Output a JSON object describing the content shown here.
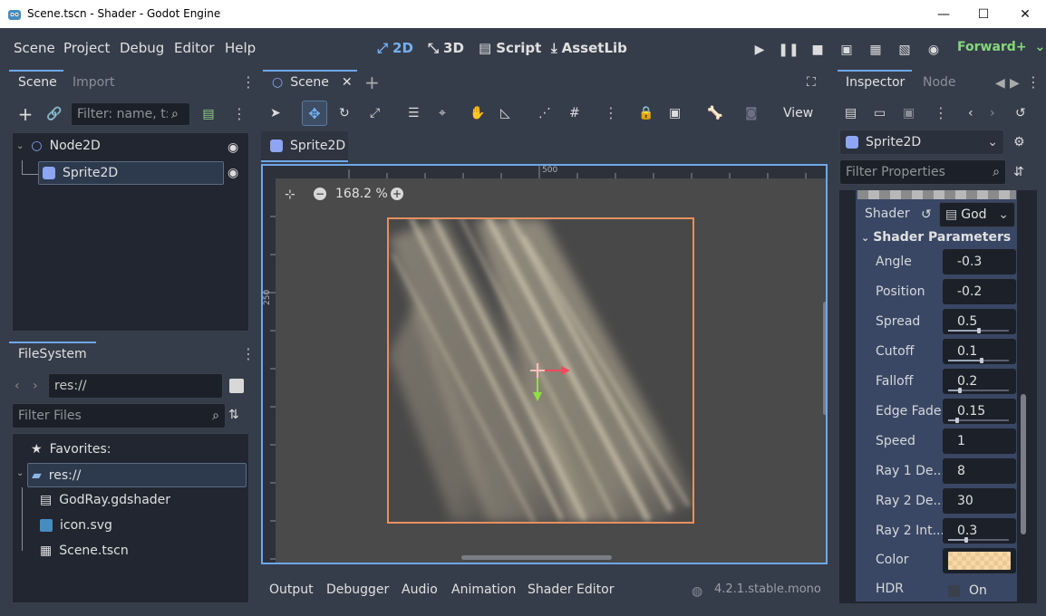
{
  "window": {
    "title": "Scene.tscn - Shader - Godot Engine",
    "minimize": "—",
    "maximize": "☐",
    "close": "✕"
  },
  "menu": {
    "items": [
      "Scene",
      "Project",
      "Debug",
      "Editor",
      "Help"
    ],
    "workspaces": [
      "2D",
      "3D",
      "Script",
      "AssetLib"
    ],
    "renderer": "Forward+"
  },
  "scene_dock": {
    "tabs": [
      "Scene",
      "Import"
    ],
    "filter_placeholder": "Filter: name, t:t",
    "nodes": [
      "Node2D",
      "Sprite2D"
    ]
  },
  "filesystem_dock": {
    "tab": "FileSystem",
    "path": "res://",
    "filter_placeholder": "Filter Files",
    "favorites": "Favorites:",
    "root": "res://",
    "files": [
      "GodRay.gdshader",
      "icon.svg",
      "Scene.tscn"
    ]
  },
  "editor": {
    "scene_tab": "Scene",
    "view_menu": "View",
    "node_tab": "Sprite2D",
    "zoom": "168.2 %",
    "ruler_x": "500",
    "ruler_y": "250",
    "bottom_tabs": [
      "Output",
      "Debugger",
      "Audio",
      "Animation",
      "Shader Editor"
    ],
    "version": "4.2.1.stable.mono"
  },
  "inspector": {
    "tabs": [
      "Inspector",
      "Node"
    ],
    "object": "Sprite2D",
    "filter_placeholder": "Filter Properties",
    "shader_label": "Shader",
    "shader_value": "God",
    "section": "Shader Parameters",
    "params": [
      {
        "label": "Angle",
        "value": "-0.3"
      },
      {
        "label": "Position",
        "value": "-0.2"
      },
      {
        "label": "Spread",
        "value": "0.5",
        "slider": 0.5
      },
      {
        "label": "Cutoff",
        "value": "0.1",
        "slider": 0.55
      },
      {
        "label": "Falloff",
        "value": "0.2",
        "slider": 0.2
      },
      {
        "label": "Edge Fade",
        "value": "0.15",
        "slider": 0.15
      },
      {
        "label": "Speed",
        "value": "1"
      },
      {
        "label": "Ray 1 De...",
        "value": "8"
      },
      {
        "label": "Ray 2 De...",
        "value": "30"
      },
      {
        "label": "Ray 2 Int...",
        "value": "0.3",
        "slider": 0.3
      }
    ],
    "color_label": "Color",
    "color_hex": "#f7d8a8",
    "hdr_label": "HDR",
    "hdr_value": "On"
  }
}
